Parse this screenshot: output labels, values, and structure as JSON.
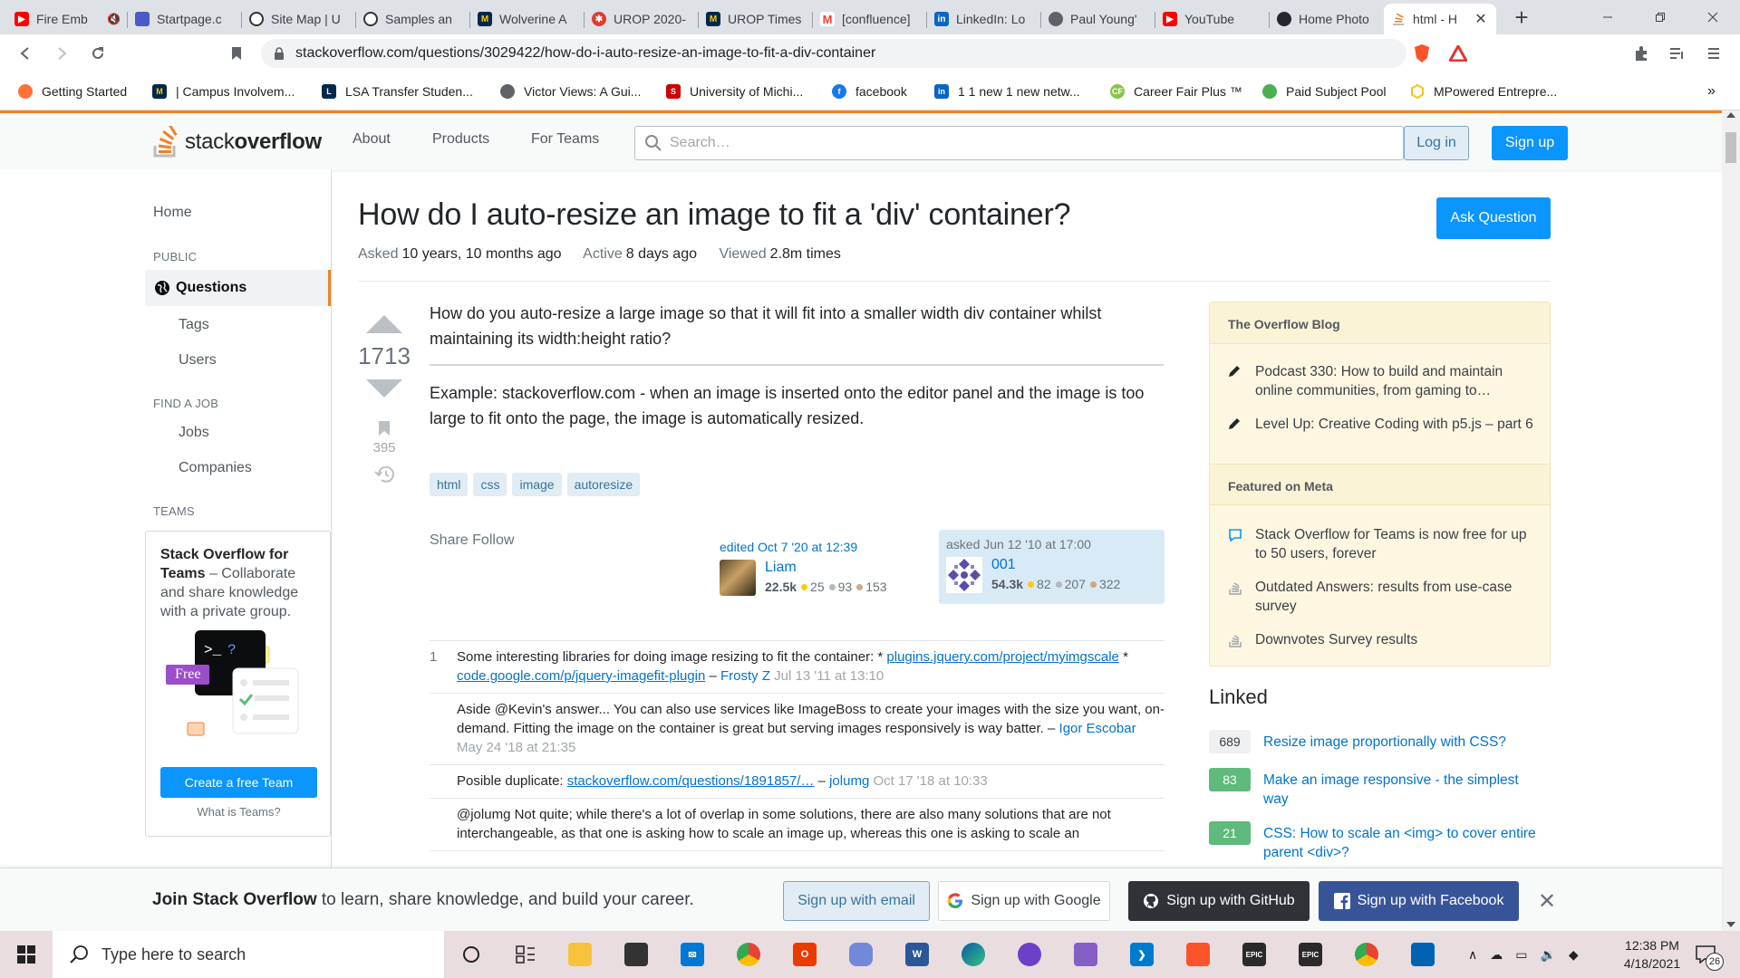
{
  "browser": {
    "tabs": [
      {
        "label": "Fire Emb",
        "icon": "youtube-icon",
        "color": "#ff0000",
        "muted": true
      },
      {
        "label": "Startpage.c",
        "icon": "startpage-icon",
        "color": "#4a5bc7"
      },
      {
        "label": "Site Map | U",
        "icon": "site-icon",
        "color": "#333333"
      },
      {
        "label": "Samples an",
        "icon": "site-icon",
        "color": "#333333"
      },
      {
        "label": "Wolverine A",
        "icon": "umich-icon",
        "color": "#00274c"
      },
      {
        "label": "UROP 2020-",
        "icon": "gear-logo-icon",
        "color": "#e03c31"
      },
      {
        "label": "UROP Times",
        "icon": "umich-icon",
        "color": "#00274c"
      },
      {
        "label": "[confluence]",
        "icon": "gmail-icon",
        "color": "#ea4335"
      },
      {
        "label": "LinkedIn: Lo",
        "icon": "linkedin-icon",
        "color": "#0a66c2"
      },
      {
        "label": "Paul Young'",
        "icon": "globe-icon",
        "color": "#5f6368"
      },
      {
        "label": "YouTube",
        "icon": "youtube-icon",
        "color": "#ff0000"
      },
      {
        "label": "Home Photo",
        "icon": "github-icon",
        "color": "#24292f"
      },
      {
        "label": "html - H",
        "icon": "stackoverflow-icon",
        "color": "#f48024",
        "active": true
      }
    ],
    "url": "stackoverflow.com/questions/3029422/how-do-i-auto-resize-an-image-to-fit-a-div-container",
    "bookmarks": [
      {
        "label": "Getting Started",
        "icon": "firefox-icon",
        "color": "#ff7139"
      },
      {
        "label": "| Campus Involvem...",
        "icon": "umich-icon",
        "color": "#00274c"
      },
      {
        "label": "LSA Transfer Studen...",
        "icon": "lsa-icon",
        "color": "#00274c"
      },
      {
        "label": "Victor Views: A Gui...",
        "icon": "globe-icon",
        "color": "#5f6368"
      },
      {
        "label": "University of Michi...",
        "icon": "bookmark-red-icon",
        "color": "#cc0000"
      },
      {
        "label": "facebook",
        "icon": "facebook-icon",
        "color": "#1877f2"
      },
      {
        "label": "1 1 new 1 new netw...",
        "icon": "linkedin-icon",
        "color": "#0a66c2"
      },
      {
        "label": "Career Fair Plus ™",
        "icon": "careerfair-icon",
        "color": "#8bc34a"
      },
      {
        "label": "Paid Subject Pool",
        "icon": "pool-icon",
        "color": "#4caf50"
      },
      {
        "label": "MPowered Entrepre...",
        "icon": "hexagon-icon",
        "color": "#f5c518"
      }
    ]
  },
  "so_header": {
    "logo_text_light": "stack",
    "logo_text_bold": "overflow",
    "nav": [
      "About",
      "Products",
      "For Teams"
    ],
    "search_placeholder": "Search…",
    "login": "Log in",
    "signup": "Sign up"
  },
  "left_nav": {
    "home": "Home",
    "public_heading": "PUBLIC",
    "questions": "Questions",
    "tags": "Tags",
    "users": "Users",
    "findjob_heading": "FIND A JOB",
    "jobs": "Jobs",
    "companies": "Companies",
    "teams_heading": "TEAMS",
    "teams_title": "Stack Overflow for Teams",
    "teams_desc": " – Collaborate and share knowledge with a private group.",
    "free_badge": "Free",
    "cta": "Create a free Team",
    "what_is": "What is Teams?"
  },
  "question": {
    "title": "How do I auto-resize an image to fit a 'div' container?",
    "ask_button": "Ask Question",
    "asked_label": "Asked",
    "asked_value": "10 years, 10 months ago",
    "active_label": "Active",
    "active_value": "8 days ago",
    "viewed_label": "Viewed",
    "viewed_value": "2.8m times",
    "votes": "1713",
    "bookmarks": "395",
    "body_p1": "How do you auto-resize a large image so that it will fit into a smaller width div container whilst maintaining its width:height ratio?",
    "body_p2": "Example: stackoverflow.com - when an image is inserted onto the editor panel and the image is too large to fit onto the page, the image is automatically resized.",
    "tags": [
      "html",
      "css",
      "image",
      "autoresize"
    ],
    "share": "Share",
    "follow": "Follow",
    "editor": {
      "action": "edited Oct 7 '20 at 12:39",
      "name": "Liam",
      "rep": "22.5k",
      "gold": "25",
      "silver": "93",
      "bronze": "153"
    },
    "asker": {
      "action": "asked Jun 12 '10 at 17:00",
      "name": "001",
      "rep": "54.3k",
      "gold": "82",
      "silver": "207",
      "bronze": "322"
    }
  },
  "comments": [
    {
      "score": "1",
      "pre": "Some interesting libraries for doing image resizing to fit the container: * ",
      "link1": "plugins.jquery.com/project/myimgscale",
      "mid": " * ",
      "link2": "code.google.com/p/jquery-imagefit-plugin",
      "dash": " – ",
      "user": "Frosty Z",
      "date": " Jul 13 '11 at 13:10"
    },
    {
      "score": "",
      "pre": "Aside @Kevin's answer... You can also use services like ImageBoss to create your images with the size you want, on-demand. Fitting the image on the container is great but serving images responsively is way batter.",
      "dash": " – ",
      "user": "Igor Escobar",
      "date": " May 24 '18 at 21:35"
    },
    {
      "score": "",
      "pre": "Posible duplicate: ",
      "link1": "stackoverflow.com/questions/1891857/…",
      "dash": " – ",
      "user": "jolumg",
      "date": " Oct 17 '18 at 10:33"
    },
    {
      "score": "",
      "pre": "@jolumg Not quite; while there's a lot of overlap in some solutions, there are also many solutions that are not interchangeable, as that one is asking how to scale an image up, whereas this one is asking to scale an"
    }
  ],
  "sidebar": {
    "blog_heading": "The Overflow Blog",
    "blog_items": [
      "Podcast 330: How to build and maintain online communities, from gaming to…",
      "Level Up: Creative Coding with p5.js – part 6"
    ],
    "meta_heading": "Featured on Meta",
    "meta_items": [
      "Stack Overflow for Teams is now free for up to 50 users, forever",
      "Outdated Answers: results from use-case survey",
      "Downvotes Survey results"
    ],
    "linked_heading": "Linked",
    "linked": [
      {
        "count": "689",
        "title": "Resize image proportionally with CSS?",
        "answered": false
      },
      {
        "count": "83",
        "title": "Make an image responsive - the simplest way",
        "answered": true
      },
      {
        "count": "21",
        "title": "CSS: How to scale an <img> to cover entire parent <div>?",
        "answered": true
      }
    ]
  },
  "join": {
    "bold": "Join Stack Overflow",
    "rest": " to learn, share knowledge, and build your career.",
    "email": "Sign up with email",
    "google": "Sign up with Google",
    "github": "Sign up with GitHub",
    "facebook": "Sign up with Facebook"
  },
  "taskbar": {
    "search_placeholder": "Type here to search",
    "time": "12:38 PM",
    "date": "4/18/2021",
    "notifications": "26"
  },
  "colors": {
    "so_orange": "#f48024",
    "so_blue": "#0a95ff",
    "link_blue": "#0074cc",
    "tag_bg": "#e1ecf4",
    "answered_green": "#5eba7d"
  }
}
